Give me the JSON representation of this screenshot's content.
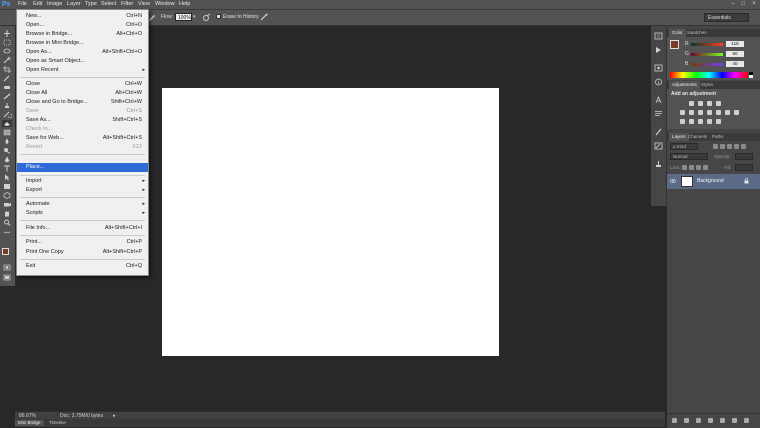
{
  "app": {
    "logo": "Ps"
  },
  "menubar": {
    "items": [
      "File",
      "Edit",
      "Image",
      "Layer",
      "Type",
      "Select",
      "Filter",
      "View",
      "Window",
      "Help"
    ],
    "window_controls": [
      "–",
      "□",
      "×"
    ]
  },
  "options": {
    "flow_label": "Flow:",
    "flow_value": "100%",
    "erase_history_label": "Erase to History",
    "workspace": "Essentials"
  },
  "file_menu": {
    "items": [
      {
        "label": "New...",
        "shortcut": "Ctrl+N"
      },
      {
        "label": "Open...",
        "shortcut": "Ctrl+O"
      },
      {
        "label": "Browse in Bridge...",
        "shortcut": "Alt+Ctrl+O"
      },
      {
        "label": "Browse in Mini Bridge...",
        "shortcut": ""
      },
      {
        "label": "Open As...",
        "shortcut": "Alt+Shift+Ctrl+O"
      },
      {
        "label": "Open as Smart Object...",
        "shortcut": ""
      },
      {
        "label": "Open Recent",
        "shortcut": ""
      },
      {
        "label": "Close",
        "shortcut": "Ctrl+W"
      },
      {
        "label": "Close All",
        "shortcut": "Alt+Ctrl+W"
      },
      {
        "label": "Close and Go to Bridge...",
        "shortcut": "Shift+Ctrl+W"
      },
      {
        "label": "Save",
        "shortcut": "Ctrl+S"
      },
      {
        "label": "Save As...",
        "shortcut": "Shift+Ctrl+S"
      },
      {
        "label": "Check In...",
        "shortcut": ""
      },
      {
        "label": "Save for Web...",
        "shortcut": "Alt+Shift+Ctrl+S"
      },
      {
        "label": "Revert",
        "shortcut": "F12"
      },
      {
        "label": "Place...",
        "shortcut": ""
      },
      {
        "label": "Import",
        "shortcut": ""
      },
      {
        "label": "Export",
        "shortcut": ""
      },
      {
        "label": "Automate",
        "shortcut": ""
      },
      {
        "label": "Scripts",
        "shortcut": ""
      },
      {
        "label": "File Info...",
        "shortcut": "Alt+Shift+Ctrl+I"
      },
      {
        "label": "Print...",
        "shortcut": "Ctrl+P"
      },
      {
        "label": "Print One Copy",
        "shortcut": "Alt+Shift+Ctrl+P"
      },
      {
        "label": "Exit",
        "shortcut": "Ctrl+Q"
      }
    ],
    "submenu_arrow": "▸"
  },
  "status": {
    "zoom": "86.67%",
    "doc": "Doc: 3.75M/0 bytes",
    "arrow": "▸"
  },
  "bottom_tabs": [
    "Mini Bridge",
    "Timeline"
  ],
  "color_panel": {
    "tabs": [
      "Color",
      "Swatches"
    ],
    "r_label": "R",
    "r_value": "118",
    "g_label": "G",
    "g_value": "60",
    "b_label": "B",
    "b_value": "40",
    "accent_fg": "#763c28"
  },
  "adjustments_panel": {
    "tabs": [
      "Adjustments",
      "Styles"
    ],
    "heading": "Add an adjustment"
  },
  "layers_panel": {
    "tabs": [
      "Layers",
      "Channels",
      "Paths"
    ],
    "kind": "ρ Kind",
    "blend": "Normal",
    "opacity_label": "Opacity:",
    "lock_label": "Lock:",
    "fill_label": "Fill:",
    "layer_name": "Background"
  }
}
